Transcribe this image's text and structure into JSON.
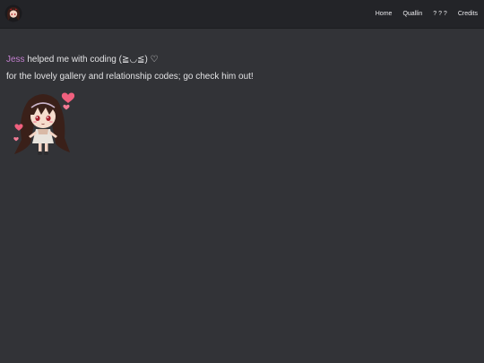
{
  "nav": {
    "items": [
      "Home",
      "Quallin",
      "? ? ?",
      "Credits"
    ]
  },
  "credits": {
    "line1": {
      "name": "Jess",
      "text": " helped me with coding (≧◡≦) ♡"
    },
    "line2": {
      "name": "",
      "text": " for the lovely gallery and relationship codes; go check him out!"
    }
  },
  "colors": {
    "background": "#323337",
    "topbar": "#232428",
    "text": "#e2e2e4",
    "jess_link": "#c27fcf",
    "second_link": "#8c2a49"
  },
  "icons": {
    "logo": "chibi-avatar-icon",
    "illustration": "chibi-girl-with-hearts"
  }
}
